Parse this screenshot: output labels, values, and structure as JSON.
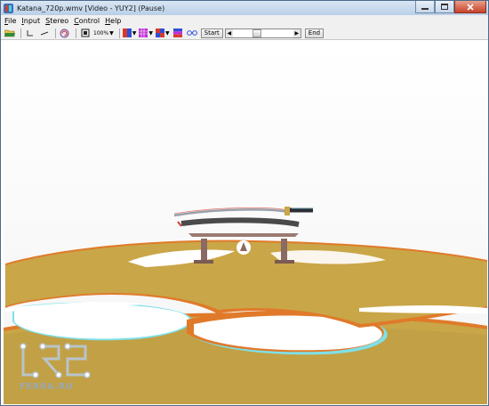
{
  "window": {
    "title": "Katana_720p.wmv [Video - YUY2] (Pause)",
    "icon": "app-icon",
    "buttons": [
      "minimize-icon",
      "maximize-icon",
      "close-icon"
    ]
  },
  "menu": [
    {
      "label": "File",
      "underline": "F",
      "rest": "ile"
    },
    {
      "label": "Input",
      "underline": "I",
      "rest": "nput"
    },
    {
      "label": "Stereo",
      "underline": "S",
      "rest": "tereo"
    },
    {
      "label": "Control",
      "underline": "C",
      "rest": "ontrol"
    },
    {
      "label": "Help",
      "underline": "H",
      "rest": "elp"
    }
  ],
  "toolbar": {
    "zoom": "100%",
    "start_label": "Start",
    "end_label": "End",
    "icons": [
      "open-folder-icon",
      "stereo-layout-icon",
      "swap-icon",
      "refresh-icon",
      "fullscreen-icon",
      "color-mode-icon",
      "color-mode-2-icon",
      "color-mode-3-icon",
      "color-mode-4-icon",
      "glasses-icon"
    ],
    "colors": {
      "red": "#d63a2f",
      "blue": "#2f4fd6",
      "magenta": "#c12fd6"
    }
  },
  "watermark": {
    "text": "FERRA.RU"
  },
  "scene": {
    "ground_color": "#c9a648",
    "shadow_orange": "#e07a2a",
    "shadow_cyan": "#7fe0e8"
  }
}
